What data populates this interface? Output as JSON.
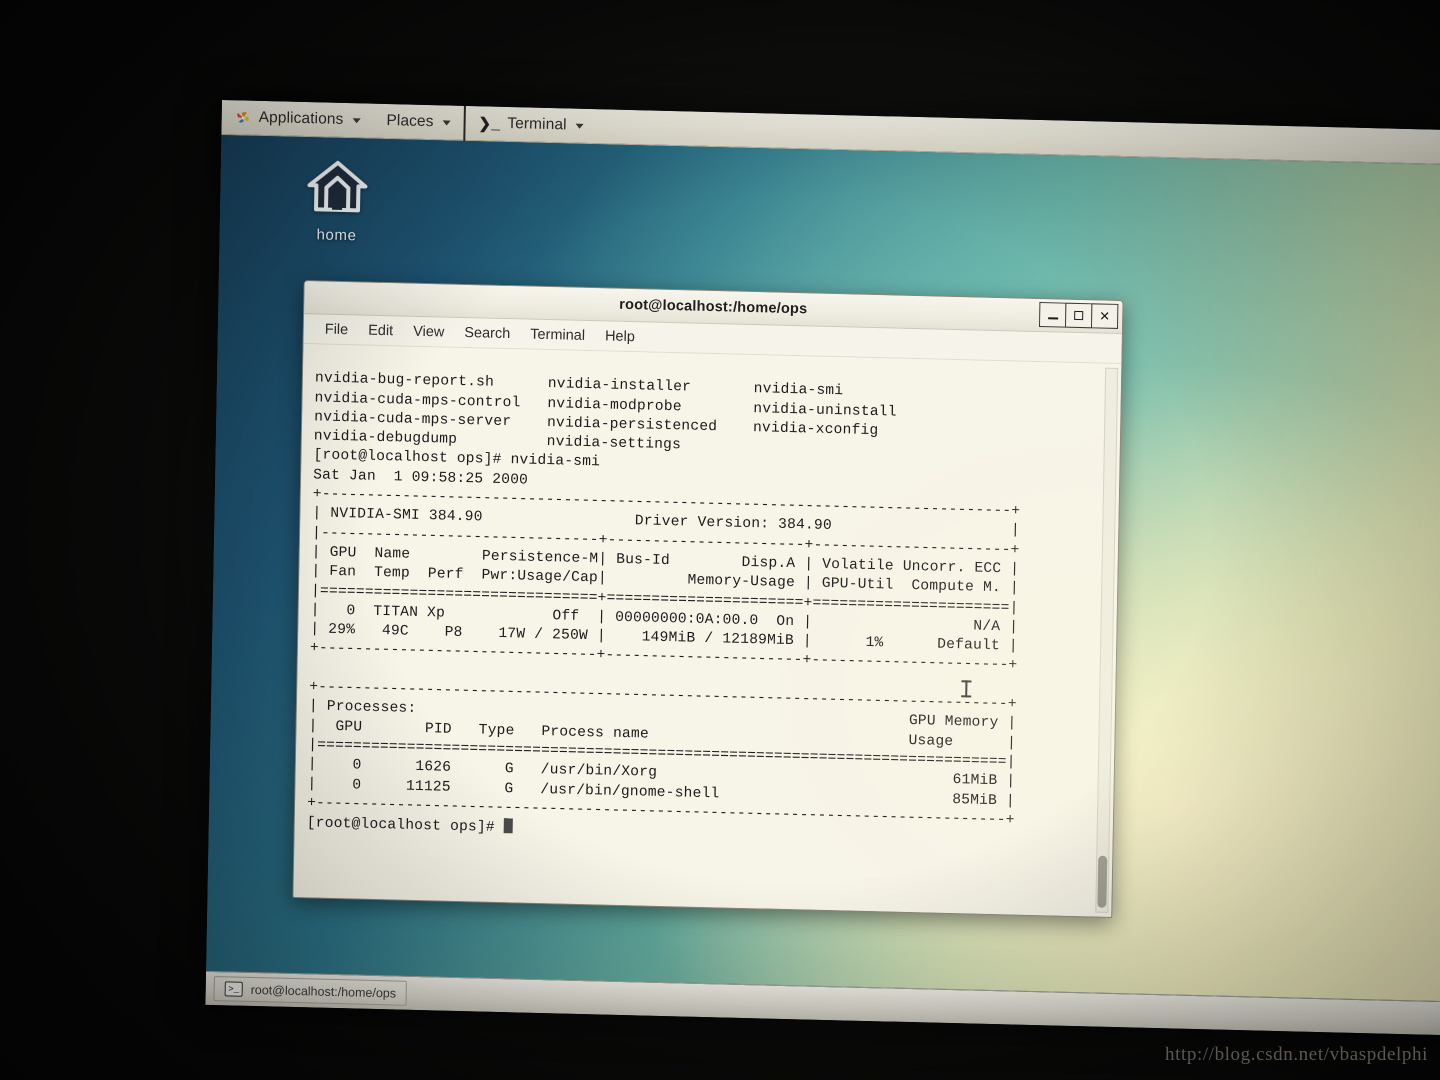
{
  "panel": {
    "applications_label": "Applications",
    "places_label": "Places",
    "terminal_label": "Terminal",
    "terminal_glyph": "❯_",
    "caret_glyph": "▾"
  },
  "desktop": {
    "home_icon_label": "home",
    "wallpaper_colors": [
      "#17405c",
      "#2c7487",
      "#62a89b",
      "#d5dcae",
      "#e7e2bb"
    ]
  },
  "taskbar": {
    "window_button_label": "root@localhost:/home/ops",
    "window_button_icon": "terminal-icon",
    "icon_glyph": ">_"
  },
  "terminal": {
    "title": "root@localhost:/home/ops",
    "window_controls": {
      "minimize": "–",
      "maximize": "❑",
      "close": "✕"
    },
    "menu": [
      "File",
      "Edit",
      "View",
      "Search",
      "Terminal",
      "Help"
    ],
    "output_lines": [
      "nvidia-bug-report.sh      nvidia-installer       nvidia-smi",
      "nvidia-cuda-mps-control   nvidia-modprobe        nvidia-uninstall",
      "nvidia-cuda-mps-server    nvidia-persistenced    nvidia-xconfig",
      "nvidia-debugdump          nvidia-settings",
      "[root@localhost ops]# nvidia-smi",
      "Sat Jan  1 09:58:25 2000",
      "+-----------------------------------------------------------------------------+",
      "| NVIDIA-SMI 384.90                 Driver Version: 384.90                    |",
      "|-------------------------------+----------------------+----------------------+",
      "| GPU  Name        Persistence-M| Bus-Id        Disp.A | Volatile Uncorr. ECC |",
      "| Fan  Temp  Perf  Pwr:Usage/Cap|         Memory-Usage | GPU-Util  Compute M. |",
      "|===============================+======================+======================|",
      "|   0  TITAN Xp            Off  | 00000000:0A:00.0  On |                  N/A |",
      "| 29%   49C    P8    17W / 250W |    149MiB / 12189MiB |      1%      Default |",
      "+-------------------------------+----------------------+----------------------+",
      "                                                                               ",
      "+-----------------------------------------------------------------------------+",
      "| Processes:                                                       GPU Memory |",
      "|  GPU       PID   Type   Process name                             Usage      |",
      "|=============================================================================|",
      "|    0      1626      G   /usr/bin/Xorg                                 61MiB |",
      "|    0     11125      G   /usr/bin/gnome-shell                          85MiB |",
      "+-----------------------------------------------------------------------------+"
    ],
    "prompt": "[root@localhost ops]# ",
    "cursor": "block-cursor"
  },
  "watermark": {
    "url": "http://blog.csdn.net/vbaspdelphi"
  }
}
